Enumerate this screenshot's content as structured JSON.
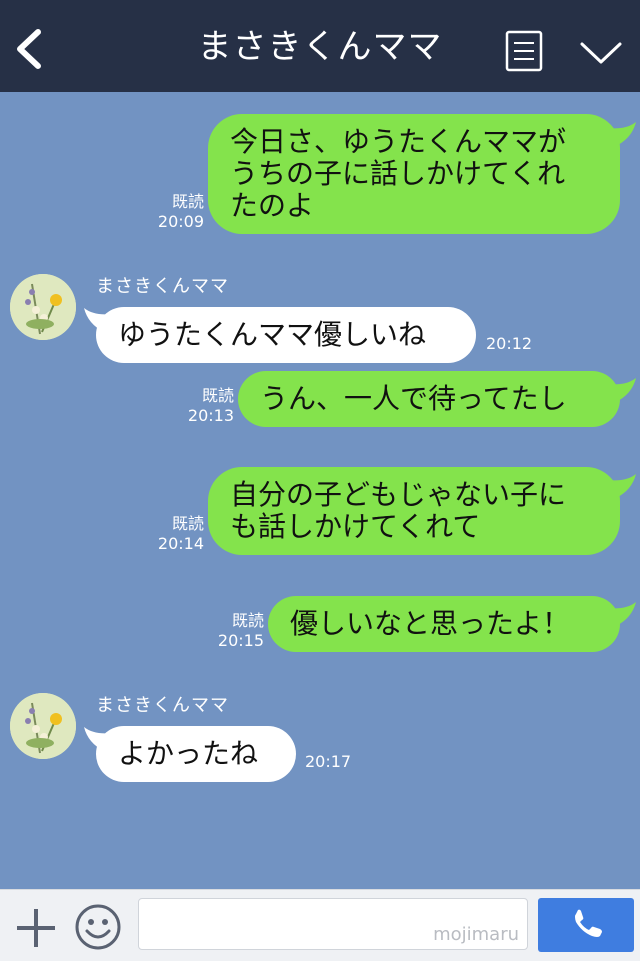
{
  "header": {
    "title": "まさきくんママ",
    "back_icon": "chevron-left-icon",
    "menu_icon": "note-list-icon",
    "collapse_icon": "chevron-down-icon"
  },
  "colors": {
    "background": "#7293c2",
    "header": "#263046",
    "my_bubble": "#84e34c",
    "their_bubble": "#ffffff",
    "call_button": "#3f7de0"
  },
  "messages": [
    {
      "side": "me",
      "lines": [
        "今日さ、ゆうたくんママが",
        "うちの子に話しかけてくれ",
        "たのよ"
      ],
      "read": "既読",
      "time": "20:09"
    },
    {
      "side": "them",
      "sender": "まさきくんママ",
      "lines": [
        "ゆうたくんママ優しいね"
      ],
      "time": "20:12"
    },
    {
      "side": "me",
      "lines": [
        "うん、一人で待ってたし"
      ],
      "read": "既読",
      "time": "20:13"
    },
    {
      "side": "me",
      "lines": [
        "自分の子どもじゃない子に",
        "も話しかけてくれて"
      ],
      "read": "既読",
      "time": "20:14"
    },
    {
      "side": "me",
      "lines": [
        "優しいなと思ったよ！"
      ],
      "read": "既読",
      "time": "20:15"
    },
    {
      "side": "them",
      "sender": "まさきくんママ",
      "lines": [
        "よかったね"
      ],
      "time": "20:17"
    }
  ],
  "input_bar": {
    "plus_icon": "plus-icon",
    "emoji_icon": "smiley-icon",
    "watermark": "mojimaru",
    "call_icon": "phone-icon"
  }
}
